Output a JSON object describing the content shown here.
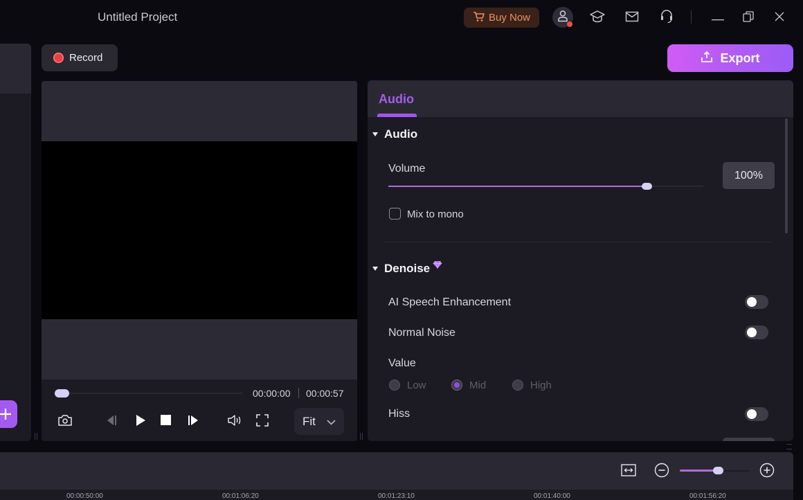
{
  "window": {
    "title": "Untitled Project",
    "buy_now_label": "Buy Now",
    "icons": [
      "cart-icon",
      "account-icon",
      "tutorial-icon",
      "mail-icon",
      "support-icon",
      "minimize-icon",
      "restore-icon",
      "close-icon"
    ]
  },
  "toolbar": {
    "record_label": "Record",
    "export_label": "Export"
  },
  "player": {
    "current_time": "00:00:00",
    "total_time": "00:00:57",
    "progress": 0,
    "fit_select": {
      "value": "Fit"
    },
    "controls": [
      "snapshot",
      "previous-frame",
      "play",
      "stop",
      "next-frame",
      "volume",
      "fullscreen"
    ]
  },
  "properties": {
    "tabs": [
      {
        "label": "Audio",
        "active": true
      }
    ],
    "audio_section": {
      "title": "Audio",
      "volume_label": "Volume",
      "volume_value": "100%",
      "volume_fraction": 0.82,
      "mix_to_mono_label": "Mix to mono",
      "mix_to_mono_checked": false
    },
    "denoise_section": {
      "title": "Denoise",
      "premium": true,
      "ai_speech_label": "AI Speech Enhancement",
      "ai_speech_on": false,
      "normal_noise_label": "Normal Noise",
      "normal_noise_on": false,
      "value_label": "Value",
      "value_options": [
        "Low",
        "Mid",
        "High"
      ],
      "value_selected": "Mid",
      "hiss_label": "Hiss",
      "hiss_on": false
    }
  },
  "timeline": {
    "zoom_fraction": 0.55,
    "ruler": [
      "00:00:50:00",
      "00:01:06:20",
      "00:01:23:10",
      "00:01:40:00",
      "00:01:56:20"
    ]
  },
  "colors": {
    "accent": "#a455ee",
    "record_red": "#ee3e45",
    "buy_now": "#e8915d",
    "background": "#0b0a10",
    "panel": "#1c1b24"
  }
}
